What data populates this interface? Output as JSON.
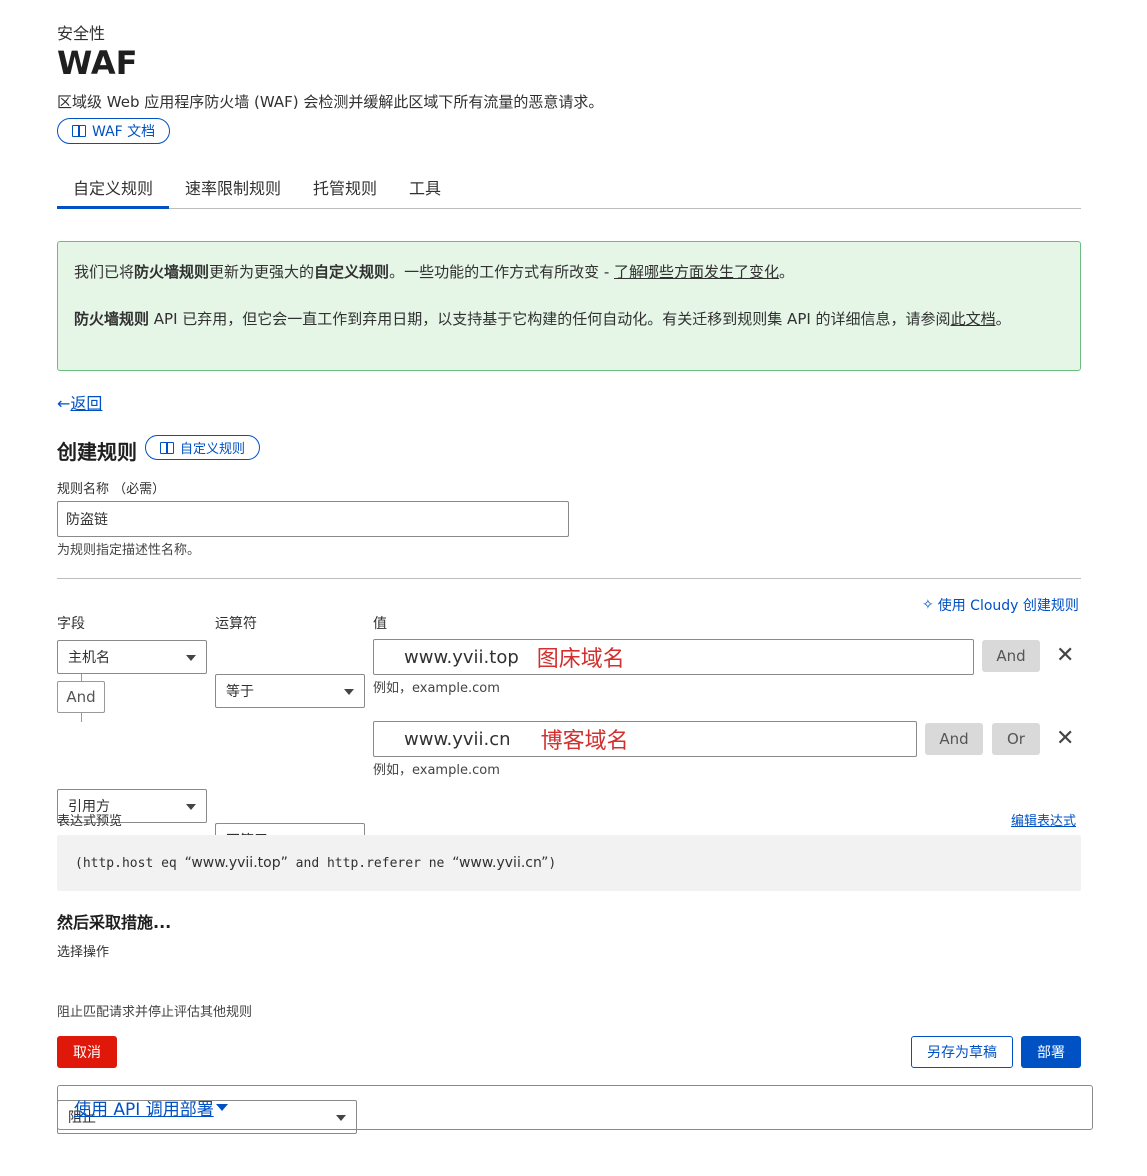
{
  "header": {
    "section": "安全性",
    "title": "WAF",
    "description": "区域级 Web 应用程序防火墙 (WAF) 会检测并缓解此区域下所有流量的恶意请求。",
    "docs_label": "WAF 文档"
  },
  "tabs": [
    "自定义规则",
    "速率限制规则",
    "托管规则",
    "工具"
  ],
  "notice": {
    "p1_a": "我们已将",
    "p1_b": "防火墙规则",
    "p1_c": "更新为更强大的",
    "p1_d": "自定义规则",
    "p1_e": "。一些功能的工作方式有所改变 - ",
    "p1_link": "了解哪些方面发生了变化",
    "p1_f": "。",
    "p2_a": "防火墙规则",
    "p2_b": " API 已弃用，但它会一直工作到弃用日期，以支持基于它构建的任何自动化。有关迁移到规则集 API 的详细信息，请参阅",
    "p2_link": "此文档",
    "p2_c": "。"
  },
  "back_label": "返回",
  "create": {
    "title": "创建规则",
    "docs_label": "自定义规则",
    "name_label": "规则名称 （必需）",
    "name_value": "防盗链",
    "name_hint": "为规则指定描述性名称。"
  },
  "builder": {
    "cloudy_label": "使用 Cloudy 创建规则",
    "col_field": "字段",
    "col_operator": "运算符",
    "col_value": "值",
    "and_connector": "And",
    "rows": [
      {
        "field": "主机名",
        "operator": "等于",
        "value": "www.yvii.top",
        "annotation": "图床域名",
        "hint": "例如，example.com",
        "and": "And"
      },
      {
        "field": "引用方",
        "operator": "不等于",
        "value": "www.yvii.cn",
        "annotation": "博客域名",
        "hint": "例如，example.com",
        "and": "And",
        "or": "Or"
      }
    ]
  },
  "expression": {
    "label": "表达式预览",
    "edit_label": "编辑表达式",
    "p1": "(http.host eq ",
    "v1": "“www.yvii.top”",
    "p2": " and http.referer ne ",
    "v2": "“www.yvii.cn”",
    "p3": ")"
  },
  "action": {
    "title": "然后采取措施...",
    "label": "选择操作",
    "value": "阻止",
    "hint": "阻止匹配请求并停止评估其他规则"
  },
  "footer": {
    "cancel": "取消",
    "save_draft": "另存为草稿",
    "deploy": "部署",
    "api_label": "使用 API 调用部署"
  },
  "colors": {
    "accent": "#0051c3",
    "annotation": "#d32f2f",
    "cancel": "#e0180a",
    "notice_bg": "#e5f5e6",
    "notice_border": "#6bbd7f"
  }
}
